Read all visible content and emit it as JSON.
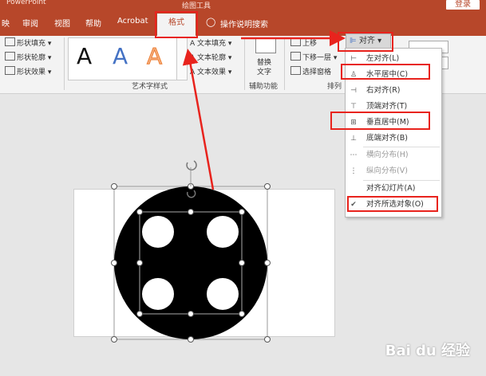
{
  "title_bar": {
    "app_name": "PowerPoint",
    "context_tab": "绘图工具",
    "login_label": "登录"
  },
  "tabs": [
    "映",
    "审阅",
    "视图",
    "帮助",
    "Acrobat",
    "格式"
  ],
  "tell_me": "操作说明搜索",
  "ribbon": {
    "shape_fill": "形状填充",
    "shape_outline": "形状轮廓",
    "shape_effects": "形状效果",
    "text_fill": "文本填充",
    "text_outline": "文本轮廓",
    "text_effects": "文本效果",
    "wordart_group": "艺术字样式",
    "alt_text_line1": "替换",
    "alt_text_line2": "文字",
    "accessibility_group": "辅助功能",
    "bring_forward": "上移",
    "send_backward": "下移一层",
    "selection_pane": "选择窗格",
    "arrange_group": "排列",
    "wordart_sample": "A"
  },
  "align_button": "对齐",
  "align_menu": [
    {
      "label": "左对齐(L)",
      "icon": "align-left-icon",
      "enabled": true
    },
    {
      "label": "水平居中(C)",
      "icon": "align-center-icon",
      "enabled": true
    },
    {
      "label": "右对齐(R)",
      "icon": "align-right-icon",
      "enabled": true
    },
    {
      "label": "顶端对齐(T)",
      "icon": "align-top-icon",
      "enabled": true
    },
    {
      "label": "垂直居中(M)",
      "icon": "align-middle-icon",
      "enabled": true
    },
    {
      "label": "底端对齐(B)",
      "icon": "align-bottom-icon",
      "enabled": true
    },
    {
      "label": "横向分布(H)",
      "icon": "distribute-horizontal-icon",
      "enabled": false
    },
    {
      "label": "纵向分布(V)",
      "icon": "distribute-vertical-icon",
      "enabled": false
    },
    {
      "label": "对齐幻灯片(A)",
      "icon": "",
      "enabled": true
    },
    {
      "label": "对齐所选对象(O)",
      "icon": "checkmark-icon",
      "enabled": true,
      "checked": true
    }
  ],
  "watermark": "Bai du 经验",
  "colors": {
    "accent": "#b7472a",
    "annotation_red": "#e8231d"
  }
}
